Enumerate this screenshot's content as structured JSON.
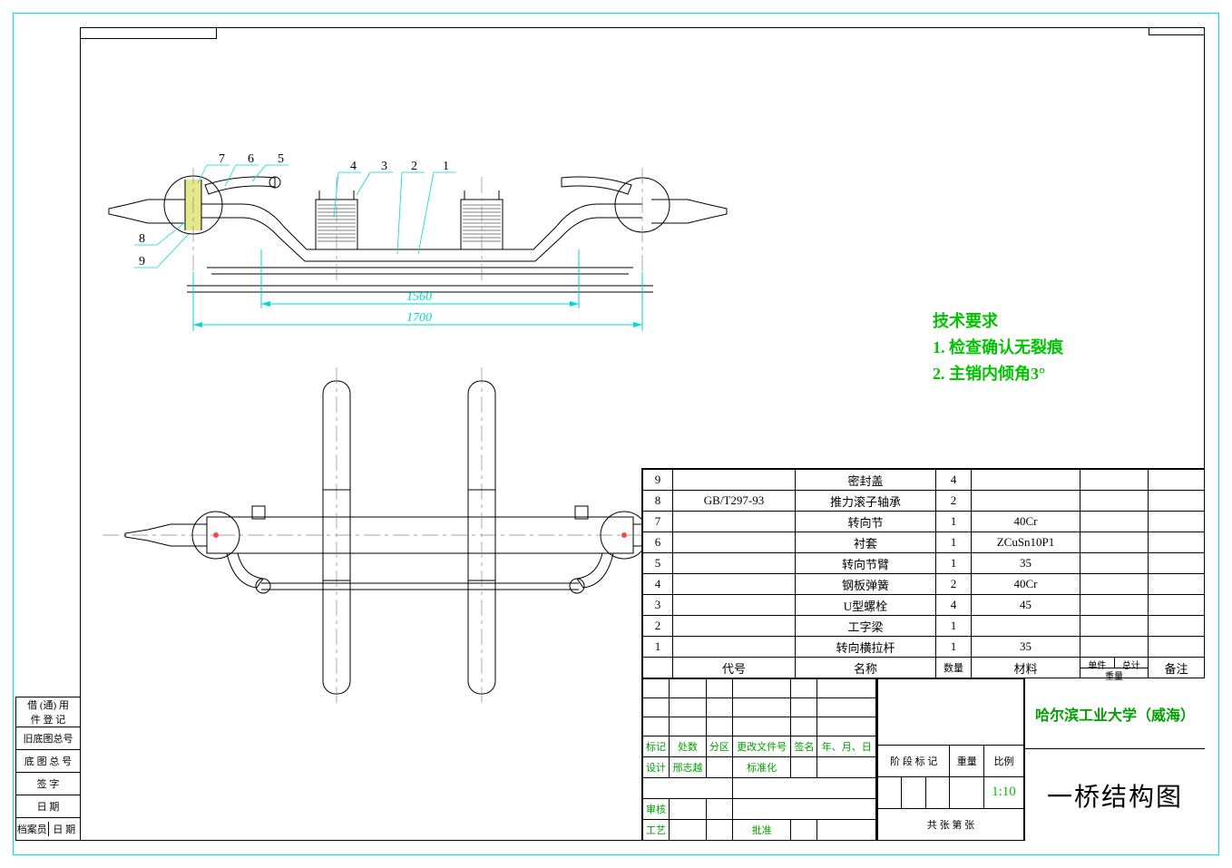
{
  "tech_requirements": {
    "heading": "技术要求",
    "line1": "1. 检查确认无裂痕",
    "line2": "2. 主销内倾角3°"
  },
  "dimensions": {
    "inner": "1560",
    "outer": "1700"
  },
  "balloons": [
    "1",
    "2",
    "3",
    "4",
    "5",
    "6",
    "7",
    "8",
    "9"
  ],
  "bom_header": {
    "code": "代号",
    "name": "名称",
    "qty": "数量",
    "material": "材料",
    "unit": "单件",
    "total": "总计",
    "weight": "重量",
    "remark": "备注"
  },
  "bom": [
    {
      "no": "9",
      "code": "",
      "name": "密封盖",
      "qty": "4",
      "material": "",
      "remark": ""
    },
    {
      "no": "8",
      "code": "GB/T297-93",
      "name": "推力滚子轴承",
      "qty": "2",
      "material": "",
      "remark": ""
    },
    {
      "no": "7",
      "code": "",
      "name": "转向节",
      "qty": "1",
      "material": "40Cr",
      "remark": ""
    },
    {
      "no": "6",
      "code": "",
      "name": "衬套",
      "qty": "1",
      "material": "ZCuSn10P1",
      "remark": ""
    },
    {
      "no": "5",
      "code": "",
      "name": "转向节臂",
      "qty": "1",
      "material": "35",
      "remark": ""
    },
    {
      "no": "4",
      "code": "",
      "name": "钢板弹簧",
      "qty": "2",
      "material": "40Cr",
      "remark": ""
    },
    {
      "no": "3",
      "code": "",
      "name": "U型螺栓",
      "qty": "4",
      "material": "45",
      "remark": ""
    },
    {
      "no": "2",
      "code": "",
      "name": "工字梁",
      "qty": "1",
      "material": "",
      "remark": ""
    },
    {
      "no": "1",
      "code": "",
      "name": "转向横拉杆",
      "qty": "1",
      "material": "35",
      "remark": ""
    }
  ],
  "lower_left": {
    "headers": [
      "标记",
      "处数",
      "分区",
      "更改文件号",
      "签名",
      "年、月、日"
    ],
    "row_design": {
      "role": "设计",
      "name": "邢志越",
      "std": "标准化"
    },
    "row_audit": "审核",
    "row_tech": "工艺",
    "approve": "批准"
  },
  "lower_mid": {
    "stage": "阶 段 标 记",
    "weight": "重量",
    "scale_label": "比例",
    "scale_value": "1:10",
    "sheet": "共    张  第    张"
  },
  "lower_right": {
    "org": "哈尔滨工业大学（威海）",
    "title": "一桥结构图"
  },
  "left_table": {
    "r1a": "借 (通) 用",
    "r1b": "件 登 记",
    "r2": "旧底图总号",
    "r3": "底 图 总 号",
    "r4": "签    字",
    "r5": "日    期",
    "r6a": "档案员",
    "r6b": "日 期"
  }
}
